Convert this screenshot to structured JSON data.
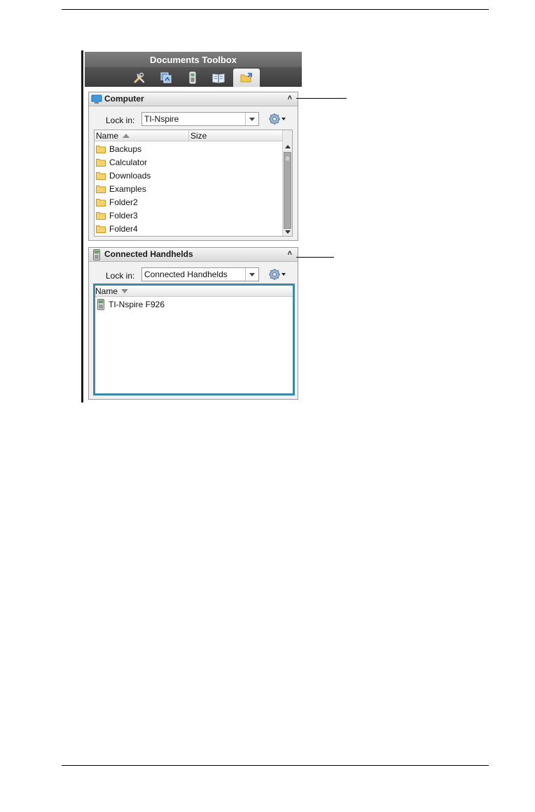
{
  "toolbox": {
    "title": "Documents Toolbox",
    "tabs": [
      {
        "name": "utilities",
        "icon": "tools-icon"
      },
      {
        "name": "page-sorter",
        "icon": "page-sorter-icon"
      },
      {
        "name": "emulator",
        "icon": "handheld-icon"
      },
      {
        "name": "content-explorer",
        "icon": "book-icon"
      },
      {
        "name": "content-workspace",
        "icon": "folder-export-icon",
        "active": true
      }
    ]
  },
  "computer_panel": {
    "title": "Computer",
    "lookin_label": "Lock in:",
    "lookin_value": "TI-Nspire",
    "columns": [
      "Name",
      "Size"
    ],
    "items": [
      "Backups",
      "Calculator",
      "Downloads",
      "Examples",
      "Folder2",
      "Folder3",
      "Folder4"
    ]
  },
  "handhelds_panel": {
    "title": "Connected Handhelds",
    "lookin_label": "Lock in:",
    "lookin_value": "Connected Handhelds",
    "columns": [
      "Name"
    ],
    "items": [
      "TI-Nspire F926"
    ]
  },
  "colors": {
    "header_bg": "#707070",
    "tab_strip_bg": "#484848",
    "folder_yellow": "#f3c94e",
    "selection_border": "#3d8aa8"
  }
}
